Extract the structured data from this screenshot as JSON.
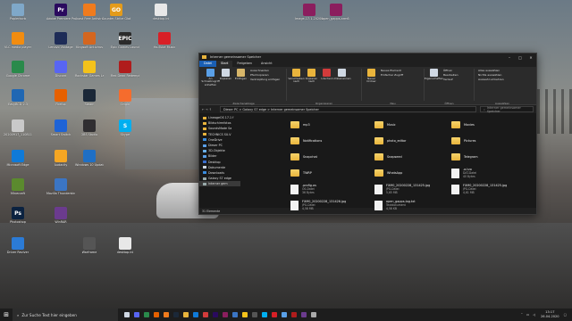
{
  "desktop_icons": [
    {
      "label": "Papierkorb",
      "color": "#7fa8c9",
      "glyph": ""
    },
    {
      "label": "Adobe Premiere Pro 2020",
      "color": "#2a0a5e",
      "glyph": "Pr"
    },
    {
      "label": "Avast Free Antivirus",
      "color": "#f07b1d",
      "glyph": ""
    },
    {
      "label": "Counter-Strike Global Offensive",
      "color": "#e49b1a",
      "glyph": "GO"
    },
    {
      "label": "desktop.ini",
      "color": "#e8e8e8",
      "glyph": ""
    },
    {
      "label": "Image-17.1-20200...",
      "color": "#8b1e5e",
      "glyph": ""
    },
    {
      "label": "open_gapps-arm6...",
      "color": "#8b1e5e",
      "glyph": ""
    },
    {
      "label": "VLC media player",
      "color": "#f28c0f",
      "glyph": ""
    },
    {
      "label": "Lenovo Vantage",
      "color": "#1e2c57",
      "glyph": ""
    },
    {
      "label": "Kingsoft Antivirus",
      "color": "#d4661f",
      "glyph": ""
    },
    {
      "label": "Epic Games Launcher",
      "color": "#2b2b2b",
      "glyph": "EPIC"
    },
    {
      "label": "YouTube Music",
      "color": "#d81f26",
      "glyph": ""
    },
    {
      "label": "Google Chrome",
      "color": "#2a8a4b",
      "glyph": ""
    },
    {
      "label": "Discord",
      "color": "#5865f2",
      "glyph": ""
    },
    {
      "label": "Rockstar Games Launcher",
      "color": "#f4c21b",
      "glyph": ""
    },
    {
      "label": "Red Dead Redemption 2",
      "color": "#b01c1c",
      "glyph": ""
    },
    {
      "label": "EasyBCD 2.3",
      "color": "#2067b3",
      "glyph": ""
    },
    {
      "label": "Firefox",
      "color": "#e66000",
      "glyph": ""
    },
    {
      "label": "Steam",
      "color": "#1b2838",
      "glyph": ""
    },
    {
      "label": "Origin",
      "color": "#f56c2d",
      "glyph": ""
    },
    {
      "label": "20200917_110811.jpg",
      "color": "#c9c9c9",
      "glyph": ""
    },
    {
      "label": "Smart Switch",
      "color": "#1e63d6",
      "glyph": ""
    },
    {
      "label": "OBS Studio",
      "color": "#302e31",
      "glyph": ""
    },
    {
      "label": "Skype",
      "color": "#00aff0",
      "glyph": "S"
    },
    {
      "label": "Microsoft Edge",
      "color": "#0f7ad8",
      "glyph": ""
    },
    {
      "label": "Audacity",
      "color": "#f5a623",
      "glyph": ""
    },
    {
      "label": "Windows 10 Update Assistant",
      "color": "#1f6fc5",
      "glyph": ""
    },
    {
      "label": "Minecraft",
      "color": "#5b8a2e",
      "glyph": ""
    },
    {
      "label": "Mozilla Thunderbird",
      "color": "#3b75c4",
      "glyph": ""
    },
    {
      "label": "Photoshop",
      "color": "#0b2240",
      "glyph": "Ps"
    },
    {
      "label": "WinRAR",
      "color": "#6b3b8e",
      "glyph": ""
    },
    {
      "label": "Driver Reviver",
      "color": "#2b7bd6",
      "glyph": ""
    },
    {
      "label": "Warframe",
      "color": "#555",
      "glyph": ""
    },
    {
      "label": "desktop.ini",
      "color": "#e8e8e8",
      "glyph": ""
    }
  ],
  "window": {
    "title": "Interner gemeinsamer Speicher",
    "tabs": [
      "Datei",
      "Start",
      "Freigeben",
      "Ansicht"
    ],
    "ribbon": {
      "pin": "An Schnellzugriff anheften",
      "copy": "Kopieren",
      "paste": "Einfügen",
      "cut": "Ausschneiden",
      "copy_path": "Pfad kopieren",
      "paste_link": "Verknüpfung einfügen",
      "clipboard_group": "Zwischenablage",
      "move_to": "Verschieben nach",
      "copy_to": "Kopieren nach",
      "delete": "Löschen",
      "rename": "Umbenennen",
      "new_folder": "Neuer Ordner",
      "new_item": "Neues Element",
      "easy_access": "Einfacher Zugriff",
      "organize_group": "Organisieren",
      "new_group": "Neu",
      "properties": "Eigenschaften",
      "open": "Öffnen",
      "edit": "Bearbeiten",
      "history": "Verlauf",
      "open_group": "Öffnen",
      "select_all": "Alles auswählen",
      "select_none": "Nichts auswählen",
      "invert": "Auswahl umkehren",
      "select_group": "Auswählen"
    },
    "address": {
      "path": "Dieser PC  >  Galaxy S7 edge  >  Interner gemeinsamer Speicher",
      "search_placeholder": "Interner gemeinsamer Speicher"
    },
    "nav": [
      "LineageOS 17.1 f",
      "Bildschirmfotos",
      "SoundsMade Sa",
      "TECHNICS SU-V",
      "OneDrive",
      "Dieser PC",
      "3D-Objekte",
      "Bilder",
      "Desktop",
      "Dokumente",
      "Downloads",
      "Galaxy S7 edge",
      "Interner gem"
    ],
    "items": [
      {
        "name": "mp3",
        "type": "folder"
      },
      {
        "name": "Music",
        "type": "folder"
      },
      {
        "name": "Movies",
        "type": "folder"
      },
      {
        "name": "Notifications",
        "type": "folder"
      },
      {
        "name": "photo_editor",
        "type": "folder"
      },
      {
        "name": "Pictures",
        "type": "folder"
      },
      {
        "name": "Snapchat",
        "type": "folder"
      },
      {
        "name": "Snapseed",
        "type": "folder"
      },
      {
        "name": "Telegram",
        "type": "folder"
      },
      {
        "name": "TWRP",
        "type": "folder"
      },
      {
        "name": "WhatsApp",
        "type": "folder"
      },
      {
        "name": ".a-tvo",
        "type": "file",
        "meta1": "DAT-Datei",
        "meta2": "40 Bytes"
      },
      {
        "name": ".profig.os",
        "type": "file",
        "meta1": "OS-Datei",
        "meta2": "36 Bytes"
      },
      {
        "name": "FXM0_20200228_131425.jpg",
        "type": "file",
        "meta1": "JPG-Datei",
        "meta2": "5,65 MB"
      },
      {
        "name": "FXM0_20200228_131425.jpg",
        "type": "file",
        "meta1": "JPG-Datei",
        "meta2": "4,61 MB"
      },
      {
        "name": "FXM0_20200228_131426.jpg",
        "type": "file",
        "meta1": "JPG-Datei",
        "meta2": "4,58 MB"
      },
      {
        "name": "open_gapps-log.txt",
        "type": "file",
        "meta1": "Textdokument",
        "meta2": "4,58 KB"
      }
    ],
    "status": "31 Elemente"
  },
  "taskbar": {
    "search_placeholder": "Zur Suche Text hier eingeben",
    "time": "13:17",
    "date": "26.04.2020"
  }
}
